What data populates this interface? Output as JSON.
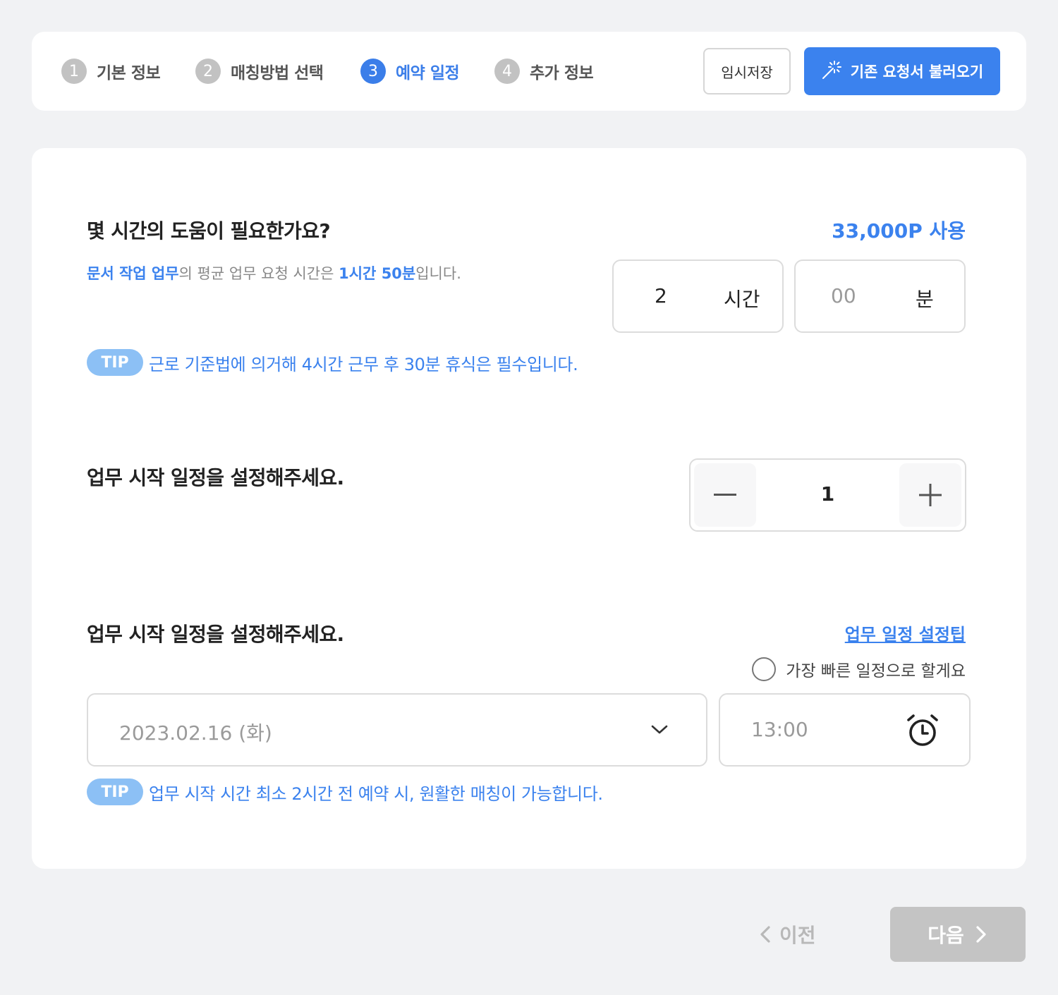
{
  "stepper": {
    "steps": [
      {
        "num": "1",
        "label": "기본 정보"
      },
      {
        "num": "2",
        "label": "매칭방법 선택"
      },
      {
        "num": "3",
        "label": "예약 일정"
      },
      {
        "num": "4",
        "label": "추가 정보"
      }
    ],
    "active_step": 3,
    "temp_save_label": "임시저장",
    "load_request_label": "기존 요청서 불러오기"
  },
  "duration": {
    "title": "몇 시간의 도움이 필요한가요?",
    "points": "33,000P 사용",
    "desc_category": "문서 작업 업무",
    "desc_middle": "의 평균 업무 요청 시간은 ",
    "desc_avg": "1시간 50분",
    "desc_end": "입니다.",
    "hours_value": "2",
    "hours_unit": "시간",
    "minutes_value": "00",
    "minutes_unit": "분",
    "tip_badge": "TIP",
    "tip_text": "근로 기준법에 의거해 4시간 근무 후 30분 휴식은 필수입니다."
  },
  "count": {
    "title": "업무 시작 일정을 설정해주세요.",
    "value": "1"
  },
  "schedule": {
    "title": "업무 시작 일정을 설정해주세요.",
    "tip_link": "업무 일정 설정팁",
    "earliest_label": "가장 빠른 일정으로 할게요",
    "date_value": "2023.02.16 (화)",
    "time_value": "13:00",
    "tip_badge": "TIP",
    "tip_text": "업무 시작 시간 최소 2시간 전 예약 시, 원활한 매칭이 가능합니다."
  },
  "nav": {
    "prev_label": "이전",
    "next_label": "다음"
  },
  "colors": {
    "accent": "#3b82ee",
    "tip_badge": "#8cc0f5",
    "disabled": "#c4c4c4"
  }
}
